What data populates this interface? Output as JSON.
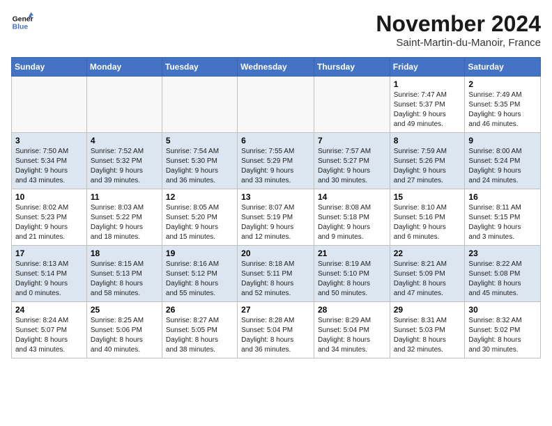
{
  "header": {
    "logo_line1": "General",
    "logo_line2": "Blue",
    "month": "November 2024",
    "location": "Saint-Martin-du-Manoir, France"
  },
  "weekdays": [
    "Sunday",
    "Monday",
    "Tuesday",
    "Wednesday",
    "Thursday",
    "Friday",
    "Saturday"
  ],
  "weeks": [
    [
      {
        "day": "",
        "detail": ""
      },
      {
        "day": "",
        "detail": ""
      },
      {
        "day": "",
        "detail": ""
      },
      {
        "day": "",
        "detail": ""
      },
      {
        "day": "",
        "detail": ""
      },
      {
        "day": "1",
        "detail": "Sunrise: 7:47 AM\nSunset: 5:37 PM\nDaylight: 9 hours\nand 49 minutes."
      },
      {
        "day": "2",
        "detail": "Sunrise: 7:49 AM\nSunset: 5:35 PM\nDaylight: 9 hours\nand 46 minutes."
      }
    ],
    [
      {
        "day": "3",
        "detail": "Sunrise: 7:50 AM\nSunset: 5:34 PM\nDaylight: 9 hours\nand 43 minutes."
      },
      {
        "day": "4",
        "detail": "Sunrise: 7:52 AM\nSunset: 5:32 PM\nDaylight: 9 hours\nand 39 minutes."
      },
      {
        "day": "5",
        "detail": "Sunrise: 7:54 AM\nSunset: 5:30 PM\nDaylight: 9 hours\nand 36 minutes."
      },
      {
        "day": "6",
        "detail": "Sunrise: 7:55 AM\nSunset: 5:29 PM\nDaylight: 9 hours\nand 33 minutes."
      },
      {
        "day": "7",
        "detail": "Sunrise: 7:57 AM\nSunset: 5:27 PM\nDaylight: 9 hours\nand 30 minutes."
      },
      {
        "day": "8",
        "detail": "Sunrise: 7:59 AM\nSunset: 5:26 PM\nDaylight: 9 hours\nand 27 minutes."
      },
      {
        "day": "9",
        "detail": "Sunrise: 8:00 AM\nSunset: 5:24 PM\nDaylight: 9 hours\nand 24 minutes."
      }
    ],
    [
      {
        "day": "10",
        "detail": "Sunrise: 8:02 AM\nSunset: 5:23 PM\nDaylight: 9 hours\nand 21 minutes."
      },
      {
        "day": "11",
        "detail": "Sunrise: 8:03 AM\nSunset: 5:22 PM\nDaylight: 9 hours\nand 18 minutes."
      },
      {
        "day": "12",
        "detail": "Sunrise: 8:05 AM\nSunset: 5:20 PM\nDaylight: 9 hours\nand 15 minutes."
      },
      {
        "day": "13",
        "detail": "Sunrise: 8:07 AM\nSunset: 5:19 PM\nDaylight: 9 hours\nand 12 minutes."
      },
      {
        "day": "14",
        "detail": "Sunrise: 8:08 AM\nSunset: 5:18 PM\nDaylight: 9 hours\nand 9 minutes."
      },
      {
        "day": "15",
        "detail": "Sunrise: 8:10 AM\nSunset: 5:16 PM\nDaylight: 9 hours\nand 6 minutes."
      },
      {
        "day": "16",
        "detail": "Sunrise: 8:11 AM\nSunset: 5:15 PM\nDaylight: 9 hours\nand 3 minutes."
      }
    ],
    [
      {
        "day": "17",
        "detail": "Sunrise: 8:13 AM\nSunset: 5:14 PM\nDaylight: 9 hours\nand 0 minutes."
      },
      {
        "day": "18",
        "detail": "Sunrise: 8:15 AM\nSunset: 5:13 PM\nDaylight: 8 hours\nand 58 minutes."
      },
      {
        "day": "19",
        "detail": "Sunrise: 8:16 AM\nSunset: 5:12 PM\nDaylight: 8 hours\nand 55 minutes."
      },
      {
        "day": "20",
        "detail": "Sunrise: 8:18 AM\nSunset: 5:11 PM\nDaylight: 8 hours\nand 52 minutes."
      },
      {
        "day": "21",
        "detail": "Sunrise: 8:19 AM\nSunset: 5:10 PM\nDaylight: 8 hours\nand 50 minutes."
      },
      {
        "day": "22",
        "detail": "Sunrise: 8:21 AM\nSunset: 5:09 PM\nDaylight: 8 hours\nand 47 minutes."
      },
      {
        "day": "23",
        "detail": "Sunrise: 8:22 AM\nSunset: 5:08 PM\nDaylight: 8 hours\nand 45 minutes."
      }
    ],
    [
      {
        "day": "24",
        "detail": "Sunrise: 8:24 AM\nSunset: 5:07 PM\nDaylight: 8 hours\nand 43 minutes."
      },
      {
        "day": "25",
        "detail": "Sunrise: 8:25 AM\nSunset: 5:06 PM\nDaylight: 8 hours\nand 40 minutes."
      },
      {
        "day": "26",
        "detail": "Sunrise: 8:27 AM\nSunset: 5:05 PM\nDaylight: 8 hours\nand 38 minutes."
      },
      {
        "day": "27",
        "detail": "Sunrise: 8:28 AM\nSunset: 5:04 PM\nDaylight: 8 hours\nand 36 minutes."
      },
      {
        "day": "28",
        "detail": "Sunrise: 8:29 AM\nSunset: 5:04 PM\nDaylight: 8 hours\nand 34 minutes."
      },
      {
        "day": "29",
        "detail": "Sunrise: 8:31 AM\nSunset: 5:03 PM\nDaylight: 8 hours\nand 32 minutes."
      },
      {
        "day": "30",
        "detail": "Sunrise: 8:32 AM\nSunset: 5:02 PM\nDaylight: 8 hours\nand 30 minutes."
      }
    ]
  ]
}
